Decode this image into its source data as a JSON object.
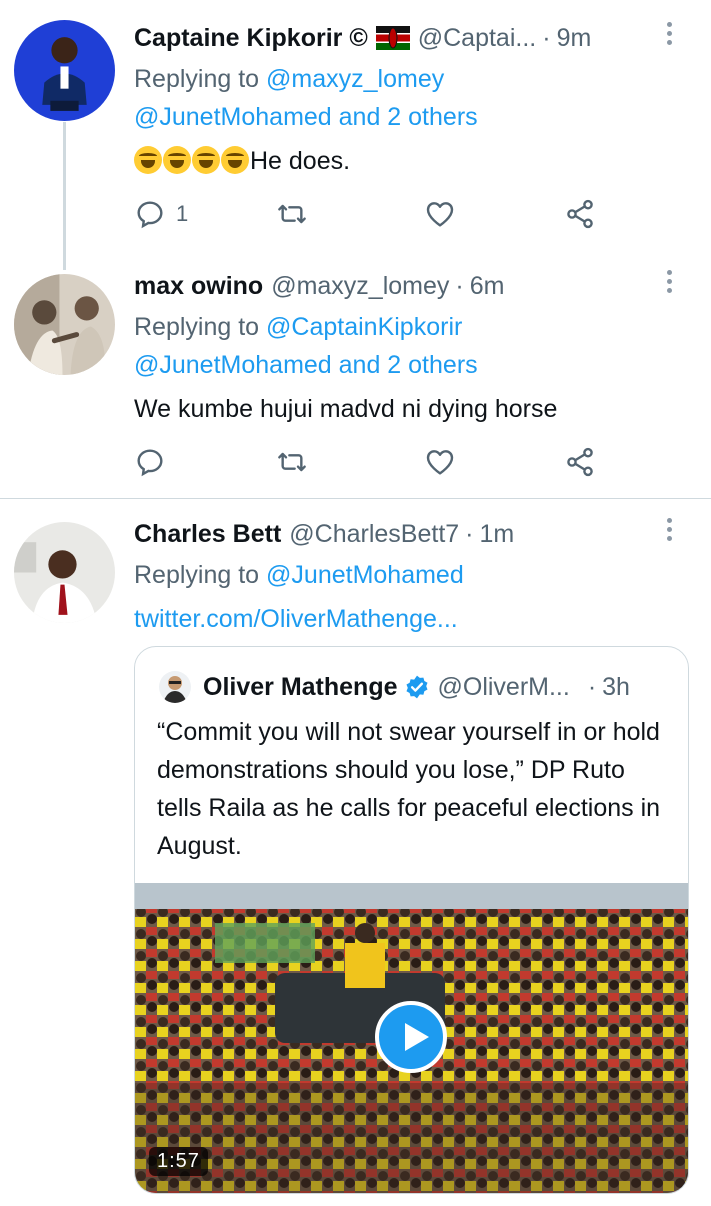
{
  "tweets": [
    {
      "name": "Captaine Kipkorir ©",
      "handle": "@Captai...",
      "time": "9m",
      "reply_prefix": "Replying to",
      "reply_to": "@maxyz_lomey",
      "reply_others": "@JunetMohamed and 2 others",
      "text": "He does.",
      "emoji_count": 4,
      "reply_count": "1"
    },
    {
      "name": "max owino",
      "handle": "@maxyz_lomey",
      "time": "6m",
      "reply_prefix": "Replying to",
      "reply_to": "@CaptainKipkorir",
      "reply_others": "@JunetMohamed and 2 others",
      "text": "We kumbe hujui madvd ni dying horse"
    },
    {
      "name": "Charles Bett",
      "handle": "@CharlesBett7",
      "time": "1m",
      "reply_prefix": "Replying to",
      "reply_to": "@JunetMohamed",
      "link": "twitter.com/OliverMathenge..."
    }
  ],
  "quote": {
    "name": "Oliver Mathenge",
    "handle": "@OliverM...",
    "time": "3h",
    "text": "“Commit you will not swear yourself in or hold demonstrations should you lose,” DP Ruto tells Raila as he calls for peaceful elections in August.",
    "video_duration": "1:57"
  },
  "separator": "·",
  "icons": {
    "reply": "reply-icon",
    "retweet": "retweet-icon",
    "like": "heart-icon",
    "share": "share-icon",
    "more": "more-vertical-icon",
    "verified": "verified-badge-icon",
    "flag": "kenya-flag-icon"
  },
  "colors": {
    "link": "#1d9bf0",
    "secondary_text": "#536471",
    "primary_text": "#0f1419",
    "divider": "#cfd9de"
  }
}
